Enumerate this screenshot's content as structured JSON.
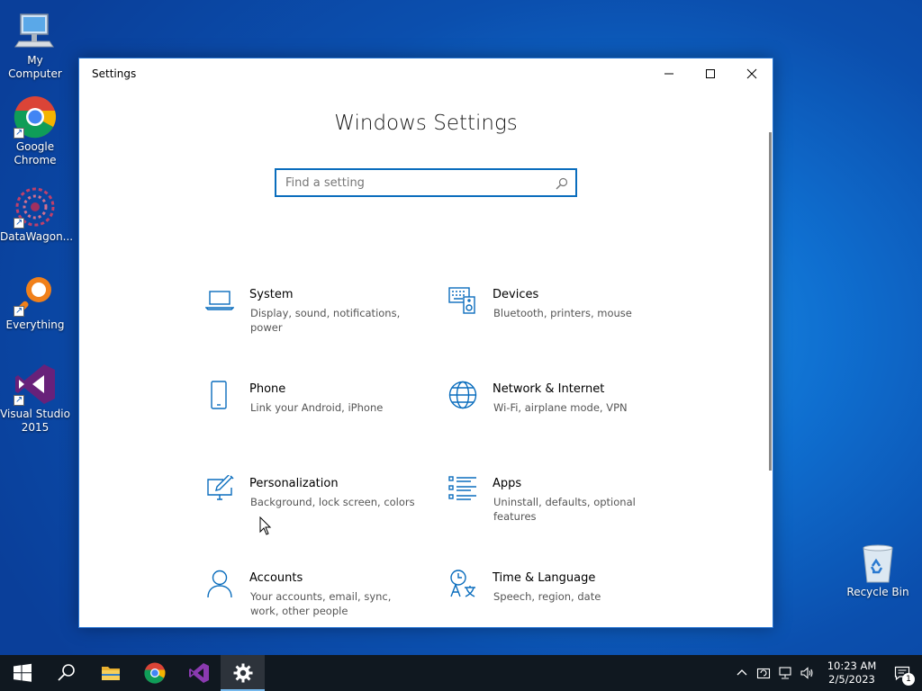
{
  "desktop": {
    "icons": [
      {
        "label": "My Computer"
      },
      {
        "label": "Google Chrome"
      },
      {
        "label": "DataWagon..."
      },
      {
        "label": "Everything"
      },
      {
        "label": "Visual Studio 2015"
      },
      {
        "label": "Recycle Bin"
      }
    ]
  },
  "window": {
    "title": "Settings",
    "heading": "Windows Settings",
    "search": {
      "placeholder": "Find a setting",
      "value": ""
    },
    "tiles": [
      {
        "name": "System",
        "desc": "Display, sound, notifications, power",
        "icon": "laptop-icon"
      },
      {
        "name": "Devices",
        "desc": "Bluetooth, printers, mouse",
        "icon": "devices-icon"
      },
      {
        "name": "Phone",
        "desc": "Link your Android, iPhone",
        "icon": "phone-icon"
      },
      {
        "name": "Network & Internet",
        "desc": "Wi-Fi, airplane mode, VPN",
        "icon": "globe-icon"
      },
      {
        "name": "Personalization",
        "desc": "Background, lock screen, colors",
        "icon": "paint-icon"
      },
      {
        "name": "Apps",
        "desc": "Uninstall, defaults, optional features",
        "icon": "apps-list-icon"
      },
      {
        "name": "Accounts",
        "desc": "Your accounts, email, sync, work, other people",
        "icon": "person-icon"
      },
      {
        "name": "Time & Language",
        "desc": "Speech, region, date",
        "icon": "time-language-icon"
      }
    ]
  },
  "taskbar": {
    "clock": {
      "time": "10:23 AM",
      "date": "2/5/2023"
    },
    "notification_count": "1"
  },
  "colors": {
    "accent": "#0a6dbd",
    "taskbar": "#101820"
  }
}
